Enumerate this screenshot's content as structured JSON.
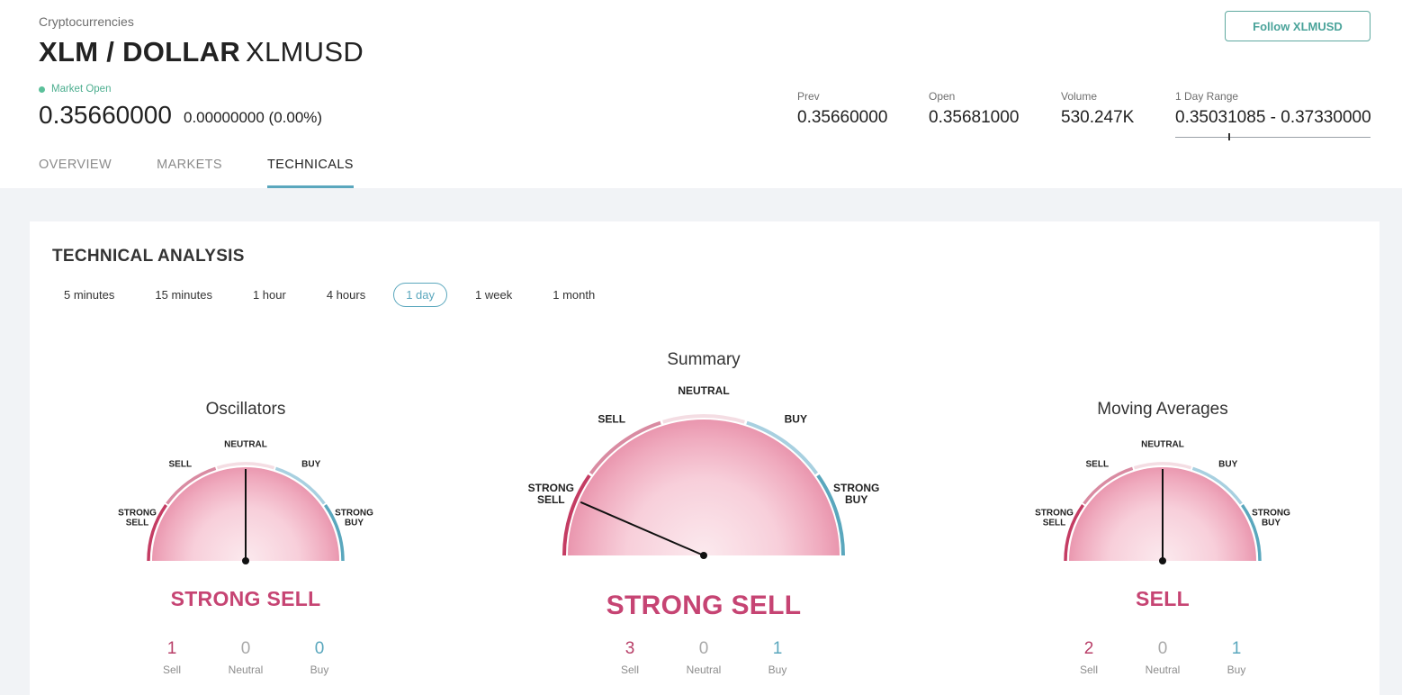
{
  "header": {
    "category": "Cryptocurrencies",
    "pair": "XLM / DOLLAR",
    "symbol": "XLMUSD",
    "follow_label": "Follow XLMUSD",
    "market_status": "Market Open",
    "price": "0.35660000",
    "change": "0.00000000 (0.00%)",
    "stats": [
      {
        "label": "Prev",
        "value": "0.35660000"
      },
      {
        "label": "Open",
        "value": "0.35681000"
      },
      {
        "label": "Volume",
        "value": "530.247K"
      },
      {
        "label": "1 Day Range",
        "value": "0.35031085 - 0.37330000"
      }
    ],
    "day_range_position": 0.27
  },
  "tabs": [
    "OVERVIEW",
    "MARKETS",
    "TECHNICALS"
  ],
  "active_tab": "TECHNICALS",
  "technical": {
    "title": "TECHNICAL ANALYSIS",
    "intervals": [
      "5 minutes",
      "15 minutes",
      "1 hour",
      "4 hours",
      "1 day",
      "1 week",
      "1 month"
    ],
    "active_interval": "1 day",
    "zone_labels": {
      "strong_sell": [
        "STRONG",
        "SELL"
      ],
      "sell": "SELL",
      "neutral": "NEUTRAL",
      "buy": "BUY",
      "strong_buy": [
        "STRONG",
        "BUY"
      ]
    },
    "count_labels": {
      "sell": "Sell",
      "neutral": "Neutral",
      "buy": "Buy"
    },
    "gauges": [
      {
        "id": "oscillators",
        "title": "Oscillators",
        "signal": "STRONG SELL",
        "needle": 0.5,
        "counts": {
          "sell": "1",
          "neutral": "0",
          "buy": "0"
        }
      },
      {
        "id": "summary",
        "title": "Summary",
        "signal": "STRONG SELL",
        "needle": 0.13,
        "counts": {
          "sell": "3",
          "neutral": "0",
          "buy": "1"
        }
      },
      {
        "id": "moving-averages",
        "title": "Moving Averages",
        "signal": "SELL",
        "needle": 0.5,
        "counts": {
          "sell": "2",
          "neutral": "0",
          "buy": "1"
        }
      }
    ]
  },
  "colors": {
    "strong_sell": "#c43c63",
    "sell": "#d98ba2",
    "neutral": "#f4dde3",
    "buy": "#a8d0e0",
    "strong_buy": "#5aa7bd",
    "signal": "#c64473",
    "accent": "#5aa7bd"
  }
}
